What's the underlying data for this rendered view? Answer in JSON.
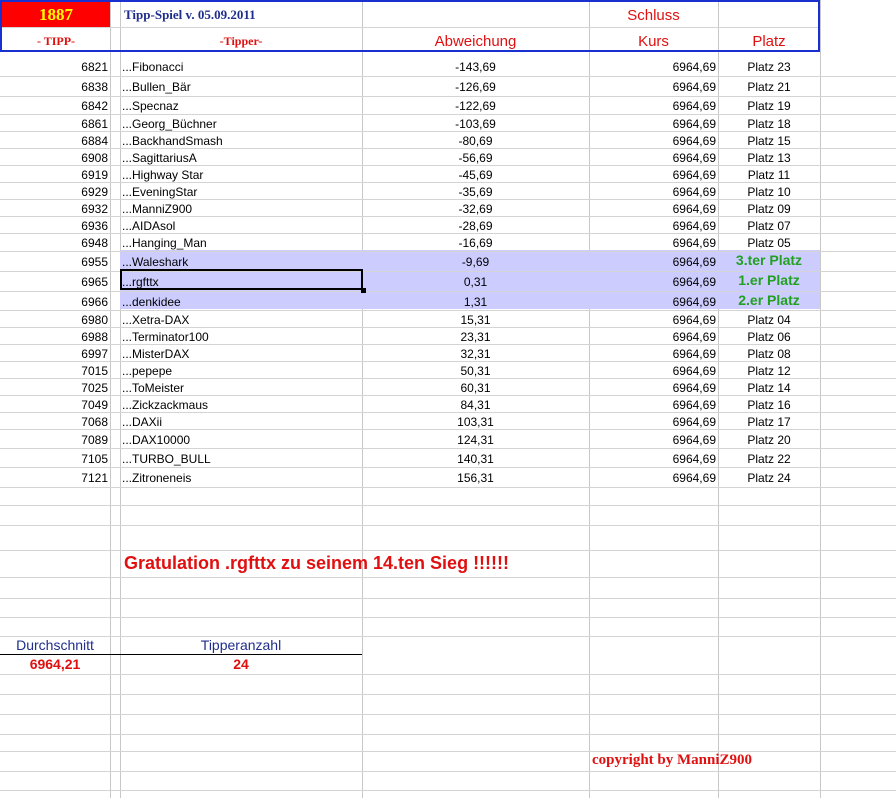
{
  "header": {
    "tip_number": "1887",
    "game_title": "Tipp-Spiel v. 05.09.2011",
    "schluss_label": "Schluss",
    "col_tipp": "- TIPP-",
    "col_tipper": "-Tipper-",
    "col_abweichung": "Abweichung",
    "col_kurs": "Kurs",
    "col_platz": "Platz"
  },
  "rows": [
    {
      "tipp": "6821",
      "tipper": "...Fibonacci",
      "abweichung": "-143,69",
      "kurs": "6964,69",
      "platz": "Platz 23"
    },
    {
      "tipp": "6838",
      "tipper": "...Bullen_Bär",
      "abweichung": "-126,69",
      "kurs": "6964,69",
      "platz": "Platz 21"
    },
    {
      "tipp": "6842",
      "tipper": "...Specnaz",
      "abweichung": "-122,69",
      "kurs": "6964,69",
      "platz": "Platz 19"
    },
    {
      "tipp": "6861",
      "tipper": "...Georg_Büchner",
      "abweichung": "-103,69",
      "kurs": "6964,69",
      "platz": "Platz 18"
    },
    {
      "tipp": "6884",
      "tipper": "...BackhandSmash",
      "abweichung": "-80,69",
      "kurs": "6964,69",
      "platz": "Platz 15"
    },
    {
      "tipp": "6908",
      "tipper": "...SagittariusA",
      "abweichung": "-56,69",
      "kurs": "6964,69",
      "platz": "Platz 13"
    },
    {
      "tipp": "6919",
      "tipper": "...Highway Star",
      "abweichung": "-45,69",
      "kurs": "6964,69",
      "platz": "Platz 11"
    },
    {
      "tipp": "6929",
      "tipper": "...EveningStar",
      "abweichung": "-35,69",
      "kurs": "6964,69",
      "platz": "Platz 10"
    },
    {
      "tipp": "6932",
      "tipper": "...ManniZ900",
      "abweichung": "-32,69",
      "kurs": "6964,69",
      "platz": "Platz 09"
    },
    {
      "tipp": "6936",
      "tipper": "...AIDAsol",
      "abweichung": "-28,69",
      "kurs": "6964,69",
      "platz": "Platz 07"
    },
    {
      "tipp": "6948",
      "tipper": "...Hanging_Man",
      "abweichung": "-16,69",
      "kurs": "6964,69",
      "platz": "Platz 05"
    },
    {
      "tipp": "6955",
      "tipper": "...Waleshark",
      "abweichung": "-9,69",
      "kurs": "6964,69",
      "platz": "3.ter Platz"
    },
    {
      "tipp": "6965",
      "tipper": "...rgfttx",
      "abweichung": "0,31",
      "kurs": "6964,69",
      "platz": "1.er Platz"
    },
    {
      "tipp": "6966",
      "tipper": "...denkidee",
      "abweichung": "1,31",
      "kurs": "6964,69",
      "platz": "2.er Platz"
    },
    {
      "tipp": "6980",
      "tipper": "...Xetra-DAX",
      "abweichung": "15,31",
      "kurs": "6964,69",
      "platz": "Platz 04"
    },
    {
      "tipp": "6988",
      "tipper": "...Terminator100",
      "abweichung": "23,31",
      "kurs": "6964,69",
      "platz": "Platz 06"
    },
    {
      "tipp": "6997",
      "tipper": "...MisterDAX",
      "abweichung": "32,31",
      "kurs": "6964,69",
      "platz": "Platz 08"
    },
    {
      "tipp": "7015",
      "tipper": "...pepepe",
      "abweichung": "50,31",
      "kurs": "6964,69",
      "platz": "Platz 12"
    },
    {
      "tipp": "7025",
      "tipper": "...ToMeister",
      "abweichung": "60,31",
      "kurs": "6964,69",
      "platz": "Platz 14"
    },
    {
      "tipp": "7049",
      "tipper": "...Zickzackmaus",
      "abweichung": "84,31",
      "kurs": "6964,69",
      "platz": "Platz 16"
    },
    {
      "tipp": "7068",
      "tipper": "...DAXii",
      "abweichung": "103,31",
      "kurs": "6964,69",
      "platz": "Platz 17"
    },
    {
      "tipp": "7089",
      "tipper": "...DAX10000",
      "abweichung": "124,31",
      "kurs": "6964,69",
      "platz": "Platz 20"
    },
    {
      "tipp": "7105",
      "tipper": "...TURBO_BULL",
      "abweichung": "140,31",
      "kurs": "6964,69",
      "platz": "Platz 22"
    },
    {
      "tipp": "7121",
      "tipper": "...Zitroneneis",
      "abweichung": "156,31",
      "kurs": "6964,69",
      "platz": "Platz 24"
    }
  ],
  "congratulation": "Gratulation  .rgfttx  zu seinem 14.ten Sieg !!!!!!",
  "summary": {
    "durchschnitt_label": "Durchschnitt",
    "durchschnitt_value": "6964,21",
    "tipperanzahl_label": "Tipperanzahl",
    "tipperanzahl_value": "24"
  },
  "copyright": "copyright by ManniZ900",
  "colors": {
    "highlight": "#ccccff",
    "header_border": "#1a2fd0",
    "accent_red": "#e01010",
    "place_green": "#22a020",
    "tip_box_bg": "#ff0000",
    "tip_box_text": "#ffff00"
  }
}
